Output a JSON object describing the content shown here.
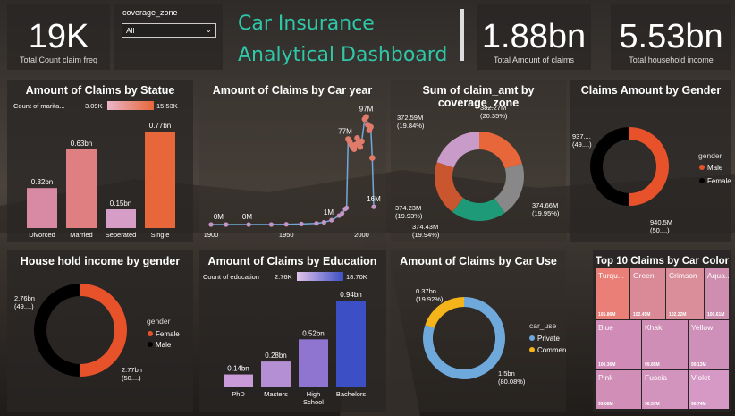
{
  "kpis": {
    "claim_count": {
      "value": "19K",
      "label": "Total Count claim freq"
    },
    "amount_claims": {
      "value": "1.88bn",
      "label": "Total Amount of claims"
    },
    "household_income": {
      "value": "5.53bn",
      "label": "Total  household income"
    }
  },
  "slicer": {
    "label": "coverage_zone",
    "selected": "All"
  },
  "dashboard_title": {
    "line1": "Car Insurance",
    "line2": "Analytical Dashboard"
  },
  "colors": {
    "orange": "#e8673a",
    "pink": "#d88a9a",
    "purple_light": "#c99bc9",
    "teal": "#1f9a78",
    "gray": "#888888",
    "rust": "#c9562f",
    "blue": "#3d4fc4",
    "blue_light": "#6fa9db",
    "yellow": "#f4b41a"
  },
  "chart_data": [
    {
      "id": "claims_by_statue",
      "type": "bar",
      "title": "Amount of Claims by Statue",
      "legend_label": "Count of marita...",
      "legend_min": "3.09K",
      "legend_max": "15.53K",
      "categories": [
        "Divorced",
        "Married",
        "Seperated",
        "Single"
      ],
      "values": [
        0.32,
        0.63,
        0.15,
        0.77
      ],
      "data_labels": [
        "0.32bn",
        "0.63bn",
        "0.15bn",
        "0.77bn"
      ],
      "colors": [
        "#d88aa5",
        "#df7f82",
        "#d69dc7",
        "#e8673a"
      ]
    },
    {
      "id": "claims_by_car_year",
      "type": "line",
      "title": "Amount of Claims by Car year",
      "x_ticks": [
        "1900",
        "1950",
        "2000"
      ],
      "annotations": [
        "0M",
        "0M",
        "1M",
        "77M",
        "97M",
        "16M"
      ],
      "x": [
        1900,
        1910,
        1925,
        1940,
        1950,
        1960,
        1970,
        1975,
        1980,
        1985,
        1987,
        1989,
        1990,
        1991,
        1992,
        1993,
        1994,
        1995,
        1996,
        1997,
        1998,
        1999,
        2000,
        2002,
        2003,
        2004,
        2005,
        2006,
        2007,
        2008
      ],
      "y": [
        0,
        0,
        0,
        0,
        0.2,
        0.5,
        1,
        2,
        4,
        8,
        10,
        14,
        15,
        77,
        75,
        72,
        70,
        68,
        72,
        78,
        74,
        70,
        75,
        95,
        97,
        90,
        85,
        88,
        60,
        16
      ]
    },
    {
      "id": "sum_claim_amt_by_zone",
      "type": "pie",
      "title": "Sum of claim_amt by coverage_zone",
      "labels": [
        "382.27M (20.35%)",
        "374.66M (19.95%)",
        "374.43M (19.94%)",
        "374.23M (19.93%)",
        "372.59M (19.84%)"
      ],
      "values": [
        382.27,
        374.66,
        374.43,
        374.23,
        372.59
      ],
      "colors": [
        "#e8673a",
        "#888888",
        "#1f9a78",
        "#c9562f",
        "#c99bc9"
      ]
    },
    {
      "id": "claims_by_gender",
      "type": "pie",
      "title": "Claims Amount by Gender",
      "legend_title": "gender",
      "categories": [
        "Male",
        "Female"
      ],
      "values": [
        940.5,
        937
      ],
      "labels": [
        "940.5M (50....)",
        "937.... (49....)"
      ],
      "colors": [
        "#e8522a",
        "#000000"
      ]
    },
    {
      "id": "income_by_gender",
      "type": "pie",
      "title": "House hold income by gender",
      "legend_title": "gender",
      "categories": [
        "Female",
        "Male"
      ],
      "values": [
        2.77,
        2.76
      ],
      "labels": [
        "2.77bn (50....)",
        "2.76bn (49....)"
      ],
      "colors": [
        "#e8522a",
        "#000000"
      ]
    },
    {
      "id": "claims_by_education",
      "type": "bar",
      "title": "Amount of Claims by Education",
      "legend_label": "Count of education",
      "legend_min": "2.76K",
      "legend_max": "18.70K",
      "categories": [
        "PhD",
        "Masters",
        "High School",
        "Bachelors"
      ],
      "values": [
        0.14,
        0.28,
        0.52,
        0.94
      ],
      "data_labels": [
        "0.14bn",
        "0.28bn",
        "0.52bn",
        "0.94bn"
      ],
      "colors": [
        "#c99bd9",
        "#b58fd4",
        "#8f75cf",
        "#3d4fc4"
      ]
    },
    {
      "id": "claims_by_car_use",
      "type": "pie",
      "title": "Amount of Claims by Car Use",
      "legend_title": "car_use",
      "categories": [
        "Private",
        "Commercial"
      ],
      "values": [
        1.5,
        0.37
      ],
      "labels": [
        "1.5bn (80.08%)",
        "0.37bn (19.92%)"
      ],
      "colors": [
        "#6fa9db",
        "#f4b41a"
      ]
    },
    {
      "id": "top10_car_color",
      "type": "heatmap",
      "title": "Top 10 Claims by Car Color",
      "categories": [
        "Turqu...",
        "Green",
        "Crimson",
        "Aqua...",
        "Blue",
        "Khaki",
        "Yellow",
        "Pink",
        "Fuscia",
        "Violet"
      ],
      "value_labels": [
        "105.86M",
        "102.45M",
        "102.22M",
        "100.61M",
        "100.36M",
        "99.85M",
        "99.13M",
        "99.08M",
        "98.57M",
        "96.74M"
      ]
    }
  ]
}
